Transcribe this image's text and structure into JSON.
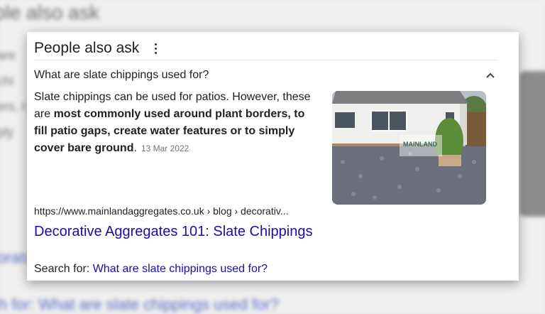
{
  "background": {
    "title_fragment": "ple also ask",
    "lines": [
      "are",
      "chi",
      "ers, t",
      "ply"
    ],
    "link_fragment": "oratı",
    "search_fragment": "h for: What are slate chippings used for?"
  },
  "panel": {
    "title": "People also ask",
    "menu_icon": "kebab-menu-icon",
    "question": "What are slate chippings used for?",
    "expand_icon": "chevron-up-icon",
    "answer": {
      "intro": "Slate chippings can be used for patios. However, these are ",
      "bold": "most commonly used around plant borders, to fill patio gaps, create water features or to simply cover bare ground",
      "outro": ".",
      "date": "13 Mar 2022"
    },
    "image_watermark": "MAINLAND",
    "source_url": "https://www.mainlandaggregates.co.uk › blog › decorativ...",
    "result_title": "Decorative Aggregates 101: Slate Chippings",
    "search_for_label": "Search for: ",
    "search_for_query": "What are slate chippings used for?"
  },
  "colors": {
    "link": "#1a0dab",
    "text": "#202124",
    "muted": "#70757a"
  }
}
